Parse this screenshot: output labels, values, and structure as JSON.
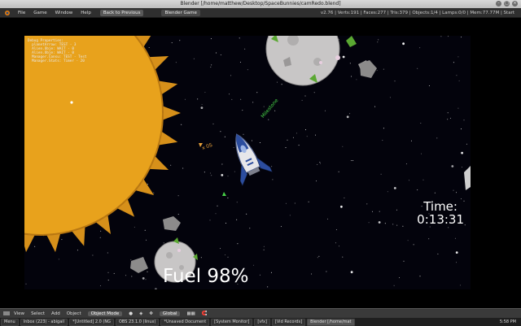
{
  "window": {
    "title": "Blender [/home/matthew/Desktop/SpaceBunnies/camRedo.blend]"
  },
  "info_header": {
    "menus": [
      "File",
      "Game",
      "Window",
      "Help"
    ],
    "back_button": "Back to Previous",
    "scene": "Blender Game",
    "stats": "v2.76 | Verts:191 | Faces:277 | Tris:379 | Objects:1/4 | Lamps:0/0 | Mem:77.77M | Start"
  },
  "viewport": {
    "debug_properties": [
      "Debug Properties:",
      "  planetArrow: TEST - 3",
      "  Alien.Obje: WAIT - 0",
      "  Alien.Obje: WAIT - 0",
      "  Manager.Consu: TEST - Test",
      "  Manager.Stats: Timer - 20"
    ],
    "label_green": "Milestone",
    "label_orange": "x 0S",
    "time_label": "Time:",
    "time_value": "0:13:31",
    "fuel": "Fuel 98%"
  },
  "view3d_header": {
    "menus": [
      "View",
      "Select",
      "Add",
      "Object"
    ],
    "mode": "Object Mode",
    "orientation": "Global"
  },
  "taskbar": {
    "start": "Menu",
    "tasks": [
      "Inbox (223) - abigail",
      "*[Untitled] 2.0 (NG",
      "OBS 23.1.0 (linux)",
      "*Unsaved Document",
      "[System Monitor]",
      "[vfx]",
      "[Vid Records]",
      "Blender [/home/mat"
    ],
    "clock": "5:58 PM"
  },
  "colors": {
    "sun": "#e8a21c",
    "sun_edge": "#c07a10",
    "fuel_text": "#ffffff",
    "label_green": "#47d247",
    "label_orange": "#e6a03a"
  }
}
